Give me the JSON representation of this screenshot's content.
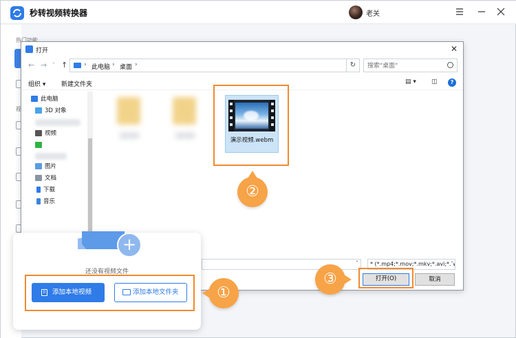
{
  "app": {
    "title": "秒转视频转换器",
    "username": "老关",
    "sidebar_section_label": "热门功能",
    "sidebar_section_label2": "视"
  },
  "dialog": {
    "title": "打开",
    "breadcrumbs": [
      "此电脑",
      "桌面"
    ],
    "search_placeholder": "搜索\"桌面\"",
    "toolbar": {
      "organize": "组织 ▾",
      "new_folder": "新建文件夹"
    },
    "nav_items": [
      "此电脑",
      "3D 对象",
      "视频",
      "图片",
      "文档",
      "下载",
      "音乐",
      "桌面"
    ],
    "file": {
      "name": "演示视频.webm"
    },
    "filter": "* (*.mp4;*.mov;*.mkv;*.avi;*.w",
    "open_button": "打开(O)",
    "cancel_button": "取消"
  },
  "upload": {
    "empty_text": "还没有视频文件",
    "add_video": "添加本地视频",
    "add_folder": "添加本地文件夹"
  },
  "markers": {
    "m1": "①",
    "m2": "②",
    "m3": "③"
  },
  "colors": {
    "accent": "#2f7be8",
    "annotation": "#f08a2e",
    "marker": "#f7a348"
  }
}
